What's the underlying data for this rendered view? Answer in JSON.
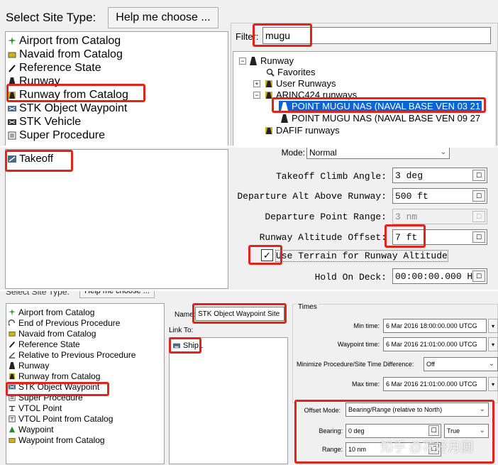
{
  "top": {
    "select_site_label": "Select Site Type:",
    "help_button": "Help me choose ...",
    "site_types": [
      {
        "label": "Airport from Catalog",
        "icon": "airport-icon"
      },
      {
        "label": "Navaid from Catalog",
        "icon": "navaid-icon"
      },
      {
        "label": "Reference State",
        "icon": "reference-state-icon"
      },
      {
        "label": "Runway",
        "icon": "runway-icon"
      },
      {
        "label": "Runway from Catalog",
        "icon": "runway-catalog-icon"
      },
      {
        "label": "STK Object Waypoint",
        "icon": "stk-waypoint-icon"
      },
      {
        "label": "STK Vehicle",
        "icon": "stk-vehicle-icon"
      },
      {
        "label": "Super Procedure",
        "icon": "super-procedure-icon"
      }
    ],
    "filter_label": "Filter:",
    "filter_value": "mugu",
    "tree": {
      "root": "Runway",
      "favorites": "Favorites",
      "user_runways": "User Runways",
      "arinc": "ARINC424 runways",
      "point1": "POINT MUGU NAS (NAVAL BASE VEN 03 21",
      "point2": "POINT MUGU NAS (NAVAL BASE VEN 09 27",
      "dafif": "DAFIF runways"
    }
  },
  "middle": {
    "procedure": "Takeoff",
    "mode_label": "Mode:",
    "mode_value": "Normal",
    "fields": [
      {
        "label": "Takeoff Climb Angle:",
        "value": "3 deg",
        "disabled": false
      },
      {
        "label": "Departure Alt Above Runway:",
        "value": "500 ft",
        "disabled": false
      },
      {
        "label": "Departure Point Range:",
        "value": "3 nm",
        "disabled": true
      },
      {
        "label": "Runway Altitude Offset:",
        "value": "7 ft",
        "disabled": false
      }
    ],
    "use_terrain_label": "Use Terrain for Runway Altitude",
    "hold_label": "Hold On Deck:",
    "hold_value": "00:00:00.000 HM"
  },
  "bottom": {
    "select_site_label": "Select Site Type:",
    "help_button": "Help me choose ...",
    "site_types": [
      {
        "label": "Airport from Catalog",
        "icon": "airport-icon"
      },
      {
        "label": "End of Previous Procedure",
        "icon": "end-previous-icon"
      },
      {
        "label": "Navaid from Catalog",
        "icon": "navaid-icon"
      },
      {
        "label": "Reference State",
        "icon": "reference-state-icon"
      },
      {
        "label": "Relative to Previous Procedure",
        "icon": "relative-previous-icon"
      },
      {
        "label": "Runway",
        "icon": "runway-icon"
      },
      {
        "label": "Runway from Catalog",
        "icon": "runway-catalog-icon"
      },
      {
        "label": "STK Object Waypoint",
        "icon": "stk-waypoint-icon"
      },
      {
        "label": "Super Procedure",
        "icon": "super-procedure-icon"
      },
      {
        "label": "VTOL Point",
        "icon": "vtol-point-icon"
      },
      {
        "label": "VTOL Point from Catalog",
        "icon": "vtol-catalog-icon"
      },
      {
        "label": "Waypoint",
        "icon": "waypoint-icon"
      },
      {
        "label": "Waypoint from Catalog",
        "icon": "waypoint-catalog-icon"
      }
    ],
    "name_label": "Name:",
    "name_value": "STK Object Waypoint Site",
    "link_to_label": "Link To:",
    "link_item": "Ship1",
    "times_label": "Times",
    "min_time_label": "Min time:",
    "min_time_value": "6 Mar 2016 18:00:00.000 UTCG",
    "waypoint_time_label": "Waypoint time:",
    "waypoint_time_value": "6 Mar 2016 21:01:00.000 UTCG",
    "minimize_label": "Minimize Procedure/Site Time Difference:",
    "minimize_value": "Off",
    "max_time_label": "Max time:",
    "max_time_value": "6 Mar 2016 21:01:00.000 UTCG",
    "offset_mode_label": "Offset Mode:",
    "offset_mode_value": "Bearing/Range (relative to North)",
    "bearing_label": "Bearing:",
    "bearing_value": "0 deg",
    "bearing_ref": "True",
    "range_label": "Range:",
    "range_value": "10 nm"
  },
  "watermark": "知乎 @花好月圆"
}
